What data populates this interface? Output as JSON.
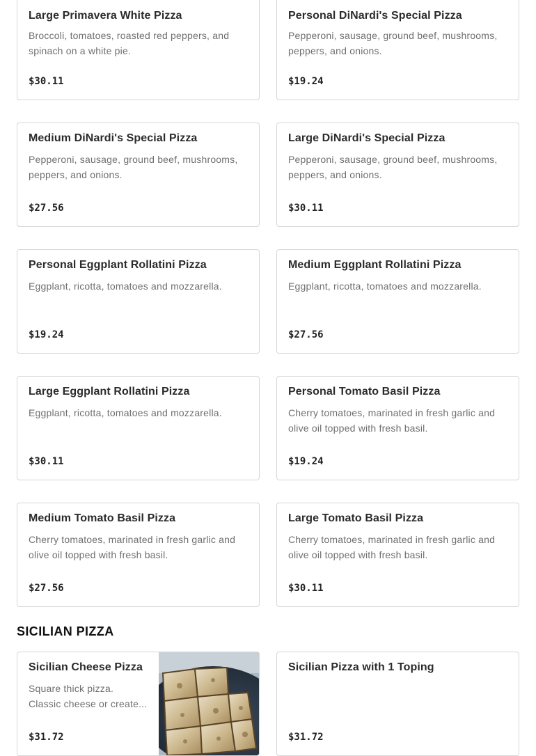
{
  "menu_items": [
    {
      "name": "Large Primavera White Pizza",
      "description": "Broccoli, tomatoes, roasted red peppers, and spinach on a white pie.",
      "price": "$30.11"
    },
    {
      "name": "Personal DiNardi's Special Pizza",
      "description": "Pepperoni, sausage, ground beef, mushrooms, peppers, and onions.",
      "price": "$19.24"
    },
    {
      "name": "Medium DiNardi's Special Pizza",
      "description": "Pepperoni, sausage, ground beef, mushrooms, peppers, and onions.",
      "price": "$27.56"
    },
    {
      "name": "Large DiNardi's Special Pizza",
      "description": "Pepperoni, sausage, ground beef, mushrooms, peppers, and onions.",
      "price": "$30.11"
    },
    {
      "name": "Personal Eggplant Rollatini Pizza",
      "description": "Eggplant, ricotta, tomatoes and mozzarella.",
      "price": "$19.24"
    },
    {
      "name": "Medium Eggplant Rollatini Pizza",
      "description": "Eggplant, ricotta, tomatoes and mozzarella.",
      "price": "$27.56"
    },
    {
      "name": "Large Eggplant Rollatini Pizza",
      "description": "Eggplant, ricotta, tomatoes and mozzarella.",
      "price": "$30.11"
    },
    {
      "name": "Personal Tomato Basil Pizza",
      "description": "Cherry tomatoes, marinated in fresh garlic and olive oil topped with fresh basil.",
      "price": "$19.24"
    },
    {
      "name": "Medium Tomato Basil Pizza",
      "description": "Cherry tomatoes, marinated in fresh garlic and olive oil topped with fresh basil.",
      "price": "$27.56"
    },
    {
      "name": "Large Tomato Basil Pizza",
      "description": "Cherry tomatoes, marinated in fresh garlic and olive oil topped with fresh basil.",
      "price": "$30.11"
    }
  ],
  "sicilian_section": {
    "title": "SICILIAN PIZZA",
    "items": [
      {
        "name": "Sicilian Cheese Pizza",
        "description": "Square thick pizza. Classic cheese or create...",
        "price": "$31.72",
        "image": "sicilian-pizza-photo"
      },
      {
        "name": "Sicilian Pizza with 1 Toping",
        "description": "",
        "price": "$31.72"
      }
    ]
  }
}
